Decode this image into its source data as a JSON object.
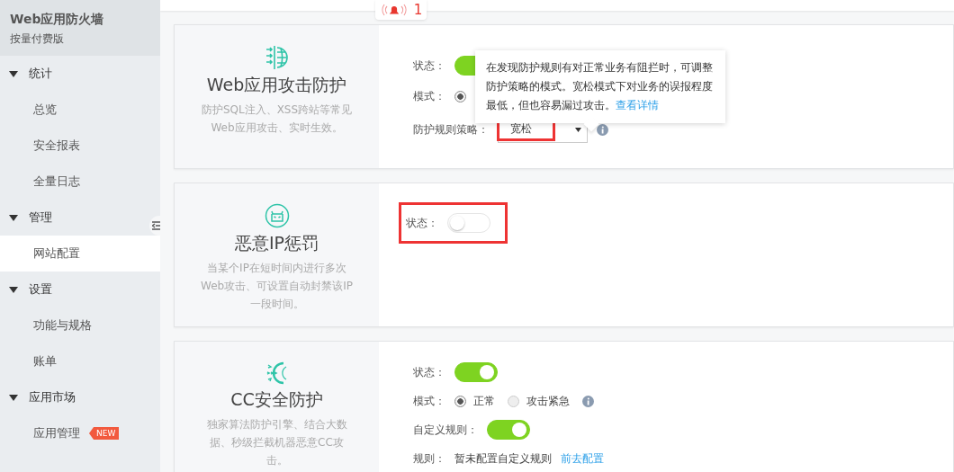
{
  "app": {
    "title": "Web应用防火墙",
    "edition": "按量付费版"
  },
  "sidebar": {
    "groups": [
      {
        "label": "统计",
        "expanded": true,
        "items": [
          {
            "label": "总览",
            "selected": false
          },
          {
            "label": "安全报表",
            "selected": false
          },
          {
            "label": "全量日志",
            "selected": false
          }
        ]
      },
      {
        "label": "管理",
        "expanded": true,
        "items": [
          {
            "label": "网站配置",
            "selected": true
          }
        ]
      },
      {
        "label": "设置",
        "expanded": true,
        "items": [
          {
            "label": "功能与规格",
            "selected": false
          },
          {
            "label": "账单",
            "selected": false
          }
        ]
      },
      {
        "label": "应用市场",
        "expanded": true,
        "items": [
          {
            "label": "应用管理",
            "selected": false,
            "badge": "NEW"
          }
        ]
      }
    ]
  },
  "alert": {
    "count": "1"
  },
  "cards": [
    {
      "kind": "web",
      "title": "Web应用攻击防护",
      "description": "防护SQL注入、XSS跨站等常见Web应用攻击、实时生效。",
      "settings": [
        {
          "kind": "toggle",
          "label": "状态：",
          "on": true
        },
        {
          "kind": "radio",
          "label": "模式：",
          "options": [
            {
              "selected": true
            }
          ]
        },
        {
          "kind": "select",
          "label": "防护规则策略：",
          "value": "宽松",
          "highlighted": true,
          "info": true
        }
      ],
      "tooltip": {
        "text": "在发现防护规则有对正常业务有阻拦时，可调整防护策略的模式。宽松模式下对业务的误报程度最低，但也容易漏过攻击。",
        "link": "查看详情"
      }
    },
    {
      "kind": "ip",
      "title": "恶意IP惩罚",
      "description": "当某个IP在短时间内进行多次Web攻击、可设置自动封禁该IP一段时间。",
      "settings": [
        {
          "kind": "toggle",
          "label": "状态：",
          "on": false,
          "highlighted": true
        }
      ]
    },
    {
      "kind": "cc",
      "title": "CC安全防护",
      "description": "独家算法防护引擎、结合大数据、秒级拦截机器恶意CC攻击。",
      "settings": [
        {
          "kind": "toggle",
          "label": "状态：",
          "on": true
        },
        {
          "kind": "radio",
          "label": "模式：",
          "info": true,
          "options": [
            {
              "label": "正常",
              "selected": true
            },
            {
              "label": "攻击紧急",
              "selected": false
            }
          ]
        },
        {
          "kind": "toggle",
          "label": "自定义规则：",
          "on": true
        },
        {
          "kind": "text",
          "label": "规则：",
          "value": "暂未配置自定义规则",
          "link": "前去配置"
        }
      ]
    }
  ]
}
